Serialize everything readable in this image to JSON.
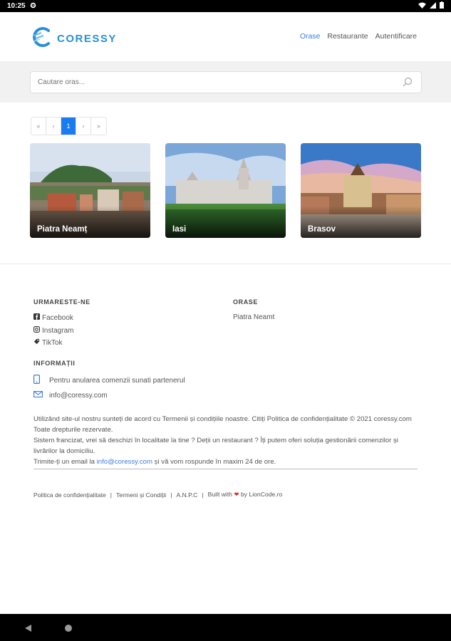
{
  "status": {
    "time": "10:25"
  },
  "brand": {
    "name": "CORESSY"
  },
  "nav": [
    {
      "label": "Orase",
      "active": true
    },
    {
      "label": "Restaurante",
      "active": false
    },
    {
      "label": "Autentificare",
      "active": false
    }
  ],
  "search": {
    "placeholder": "Cautare oras..."
  },
  "pagination": {
    "first": "«",
    "prev": "‹",
    "current": "1",
    "next": "›",
    "last": "»"
  },
  "cities": [
    {
      "name": "Piatra Neamț"
    },
    {
      "name": "Iasi"
    },
    {
      "name": "Brasov"
    }
  ],
  "footer": {
    "follow_heading": "URMARESTE-NE",
    "social": [
      "Facebook",
      "Instagram",
      "TikTok"
    ],
    "cities_heading": "ORASE",
    "cities": [
      "Piatra Neamt"
    ],
    "info_heading": "INFORMAȚII",
    "phone_text": "Pentru anularea comenzii sunati partenerul",
    "email": "info@coressy.com",
    "para1": "Utilizând site-ul nostru sunteți de acord cu Termenii și condițiile noastre. Citiți Politica de confidențialitate © 2021 coressy.com Toate drepturile rezervate.",
    "para2": "Sistem francizat, vrei să deschizi în localitate la tine ? Deții un restaurant ? Îți putem oferi soluția gestionării comenzilor și livrărilor la domiciliu.",
    "para3_pre": "Trimite-ți un email la ",
    "para3_email": "info@coressy.com",
    "para3_post": " și vă vom rospunde în maxim 24 de ore.",
    "link_privacy": "Politica de confidențialitate",
    "sep1": "|",
    "link_terms": "Termeni și Condiții",
    "sep2": "|",
    "link_anpc": "A.N.P.C",
    "sep3": "|",
    "built_pre": "Built with",
    "built_post": "by LionCode.ro"
  },
  "colors": {
    "accent": "#1a7cf0",
    "brand": "#2b8fd6",
    "link": "#3b7ddd",
    "heart": "#d92d2d"
  }
}
